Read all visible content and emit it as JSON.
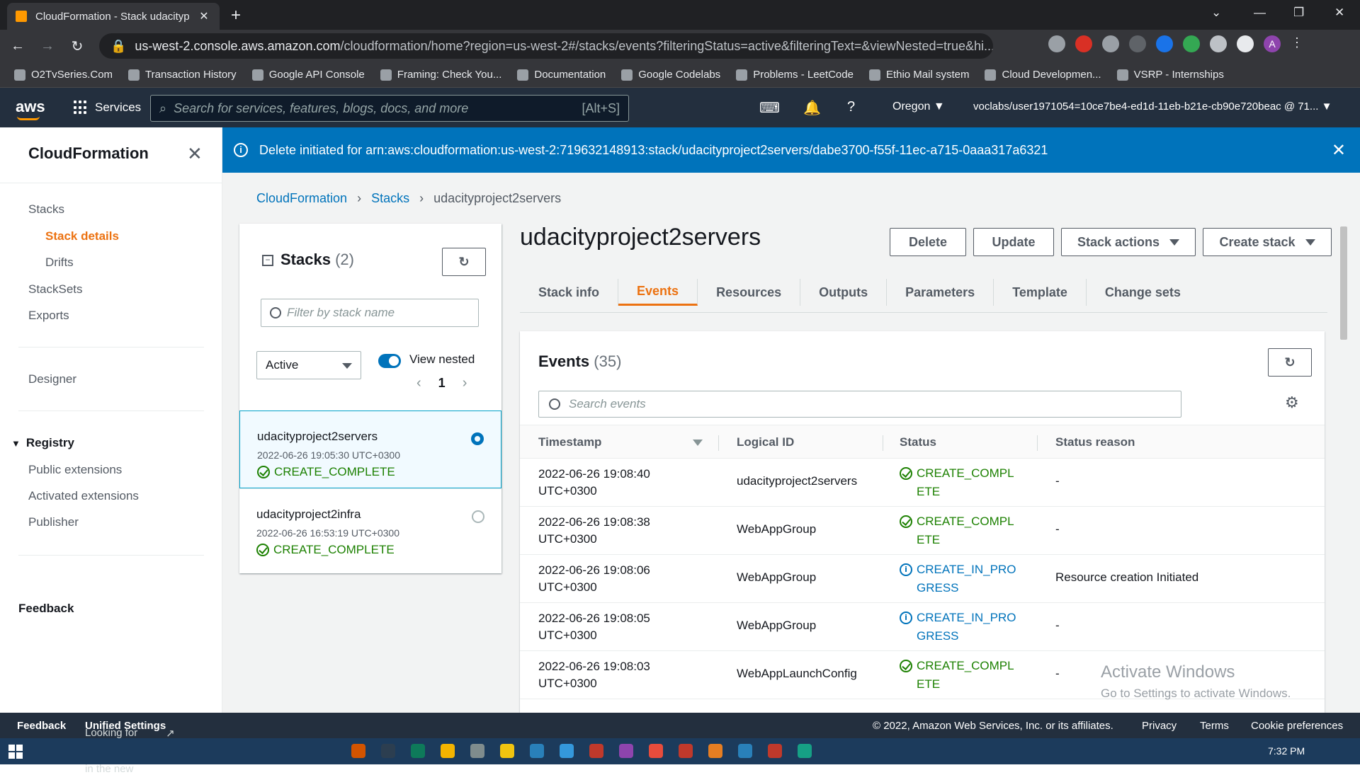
{
  "browser": {
    "tab_title": "CloudFormation - Stack udacityp",
    "url_host": "us-west-2.console.aws.amazon.com",
    "url_path": "/cloudformation/home?region=us-west-2#/stacks/events?filteringStatus=active&filteringText=&viewNested=true&hi...",
    "bookmarks": [
      "O2TvSeries.Com",
      "Transaction History",
      "Google API Console",
      "Framing: Check You...",
      "Documentation",
      "Google Codelabs",
      "Problems - LeetCode",
      "Ethio Mail system",
      "Cloud Developmen...",
      "VSRP - Internships"
    ],
    "profile_initial": "A"
  },
  "aws_nav": {
    "logo": "aws",
    "services": "Services",
    "search_placeholder": "Search for services, features, blogs, docs, and more",
    "shortcut": "[Alt+S]",
    "region": "Oregon",
    "account": "voclabs/user1971054=10ce7be4-ed1d-11eb-b21e-cb90e720beac @ 71..."
  },
  "sidebar": {
    "title": "CloudFormation",
    "items": [
      "Stacks",
      "Stack details",
      "Drifts",
      "StackSets",
      "Exports",
      "Designer"
    ],
    "registry": "Registry",
    "registry_items": [
      "Public extensions",
      "Activated extensions",
      "Publisher"
    ],
    "feedback": "Feedback"
  },
  "banner": {
    "message": "Delete initiated for arn:aws:cloudformation:us-west-2:719632148913:stack/udacityproject2servers/dabe3700-f55f-11ec-a715-0aaa317a6321"
  },
  "breadcrumb": [
    "CloudFormation",
    "Stacks",
    "udacityproject2servers"
  ],
  "stacks_panel": {
    "title": "Stacks",
    "count": "(2)",
    "filter_placeholder": "Filter by stack name",
    "status_filter": "Active",
    "view_nested": "View nested",
    "page": "1",
    "stacks": [
      {
        "name": "udacityproject2servers",
        "time": "2022-06-26 19:05:30 UTC+0300",
        "status": "CREATE_COMPLETE"
      },
      {
        "name": "udacityproject2infra",
        "time": "2022-06-26 16:53:19 UTC+0300",
        "status": "CREATE_COMPLETE"
      }
    ]
  },
  "stack": {
    "name": "udacityproject2servers",
    "actions": [
      "Delete",
      "Update",
      "Stack actions",
      "Create stack"
    ],
    "tabs": [
      "Stack info",
      "Events",
      "Resources",
      "Outputs",
      "Parameters",
      "Template",
      "Change sets"
    ]
  },
  "events": {
    "title": "Events",
    "count": "(35)",
    "search_placeholder": "Search events",
    "columns": [
      "Timestamp",
      "Logical ID",
      "Status",
      "Status reason"
    ],
    "rows": [
      {
        "date": "2022-06-26 19:08:40",
        "tz": "UTC+0300",
        "id": "udacityproject2servers",
        "status": "CREATE_COMPLETE",
        "reason": "-"
      },
      {
        "date": "2022-06-26 19:08:38",
        "tz": "UTC+0300",
        "id": "WebAppGroup",
        "status": "CREATE_COMPLETE",
        "reason": "-"
      },
      {
        "date": "2022-06-26 19:08:06",
        "tz": "UTC+0300",
        "id": "WebAppGroup",
        "status": "CREATE_IN_PROGRESS",
        "reason": "Resource creation Initiated"
      },
      {
        "date": "2022-06-26 19:08:05",
        "tz": "UTC+0300",
        "id": "WebAppGroup",
        "status": "CREATE_IN_PROGRESS",
        "reason": "-"
      },
      {
        "date": "2022-06-26 19:08:03",
        "tz": "UTC+0300",
        "id": "WebAppLaunchConfig",
        "status": "CREATE_COMPLETE",
        "reason": "-"
      }
    ]
  },
  "watermark": {
    "line1": "Activate Windows",
    "line2": "Go to Settings to activate Windows."
  },
  "footer": {
    "feedback": "Feedback",
    "language": "Looking for language selection? Find it in the new",
    "settings": "Unified Settings",
    "copyright": "© 2022, Amazon Web Services, Inc. or its affiliates.",
    "links": [
      "Privacy",
      "Terms",
      "Cookie preferences"
    ]
  },
  "taskbar": {
    "time": "7:32 PM"
  },
  "colors": {
    "aws_nav": "#232f3e",
    "accent": "#ec7211",
    "link": "#0073bb",
    "success": "#1d8102"
  }
}
